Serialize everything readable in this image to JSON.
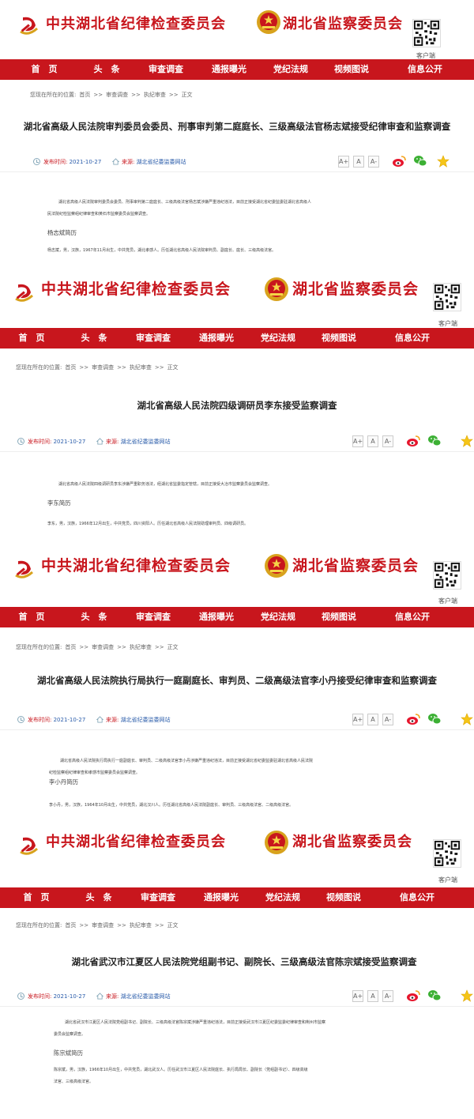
{
  "header": {
    "party_name": "中共湖北省纪律检查委员会",
    "supervision_name": "湖北省监察委员会",
    "qr_label": "客户端"
  },
  "nav": [
    "首　页",
    "头　条",
    "审查调查",
    "通报曝光",
    "党纪法规",
    "视频图说",
    "信息公开"
  ],
  "breadcrumb": {
    "prefix": "您现在所在的位置:",
    "items": [
      "首页",
      ">>",
      "审查调查",
      ">>",
      "执纪审查",
      ">>",
      "正文"
    ]
  },
  "meta": {
    "publish_label": "发布时间:",
    "source_label": "来源:",
    "font_large": "A+",
    "font_medium": "A",
    "font_small": "A-"
  },
  "colors": {
    "brand_red": "#c8161d",
    "link_blue": "#2a5caa"
  },
  "articles": [
    {
      "title": "湖北省高级人民法院审判委员会委员、刑事审判第二庭庭长、三级高级法官杨志斌接受纪律审查和监察调查",
      "date": "2021-10-27",
      "source": "湖北省纪委监委网站",
      "intro_lines": [
        "湖北省高级人民法院审判委员会委员、刑事审判第二庭庭长、三级高级法官杨志斌涉嫌严重违纪违法，目前正接受湖北省纪委监委驻湖北省高级人",
        "民法院纪检监察组纪律审查和黄石市监察委员会监察调查。"
      ],
      "bio_title": "杨志斌简历",
      "bio_lines": [
        "杨志斌，男，汉族，1967年11月出生，中共党员，湖北孝感人。历任湖北省高级人民法院审判员、副庭长、庭长、三级高级法官。"
      ]
    },
    {
      "title": "湖北省高级人民法院四级调研员李东接受监察调查",
      "date": "2021-10-27",
      "source": "湖北省纪委监委网站",
      "intro_lines": [
        "湖北省高级人民法院四级调研员李东涉嫌严重职务违法，经湖北省监委指定管辖，目前正接受大冶市监察委员会监察调查。"
      ],
      "bio_title": "李东简历",
      "bio_lines": [
        "李东，男，汉族，1966年12月出生，中共党员，四川资阳人。历任湖北省高级人民法院助理审判员、四级调研员。"
      ]
    },
    {
      "title": "湖北省高级人民法院执行局执行一庭副庭长、审判员、二级高级法官李小丹接受纪律审查和监察调查",
      "date": "2021-10-27",
      "source": "湖北省纪委监委网站",
      "intro_lines": [
        "湖北省高级人民法院执行局执行一庭副庭长、审判员、二级高级法官李小丹涉嫌严重违纪违法，目前正接受湖北省纪委监委驻湖北省高级人民法院",
        "纪检监察组纪律审查和孝感市监察委员会监察调查。"
      ],
      "bio_title": "李小丹简历",
      "bio_lines": [
        "李小丹，男，汉族，1964年10月出生，中共党员，湖北汉川人。历任湖北省高级人民法院副庭长、审判员、三级高级法官、二级高级法官。"
      ]
    },
    {
      "title": "湖北省武汉市江夏区人民法院党组副书记、副院长、三级高级法官陈宗斌接受监察调查",
      "date": "2021-10-27",
      "source": "湖北省纪委监委网站",
      "intro_lines": [
        "湖北省武汉市江夏区人民法院党组副书记、副院长、三级高级法官陈宗斌涉嫌严重违纪违法，目前正接受武汉市江夏区纪委监委纪律审查和荆州市监察",
        "委员会监察调查。"
      ],
      "bio_title": "陈宗斌简历",
      "bio_lines": [
        "陈宗斌，男，汉族，1966年10月出生，中共党员，湖北武汉人。历任武汉市江夏区人民法院庭长、执行局局长、副院长（党组副书记）、四级高级",
        "法官、三级高级法官。"
      ]
    }
  ]
}
